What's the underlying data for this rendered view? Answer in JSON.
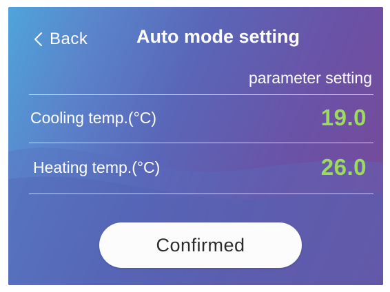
{
  "header": {
    "back_label": "Back",
    "title": "Auto mode setting"
  },
  "section": {
    "header": "parameter setting"
  },
  "parameters": [
    {
      "label": "Cooling temp.(°C)",
      "value": "19.0"
    },
    {
      "label": "Heating temp.(°C)",
      "value": "26.0"
    }
  ],
  "confirm_label": "Confirmed",
  "icons": {
    "back": "chevron-left-icon"
  },
  "colors": {
    "value_green": "#9bdb5e",
    "button_bg": "#fcfcfc",
    "text": "#ffffff"
  }
}
